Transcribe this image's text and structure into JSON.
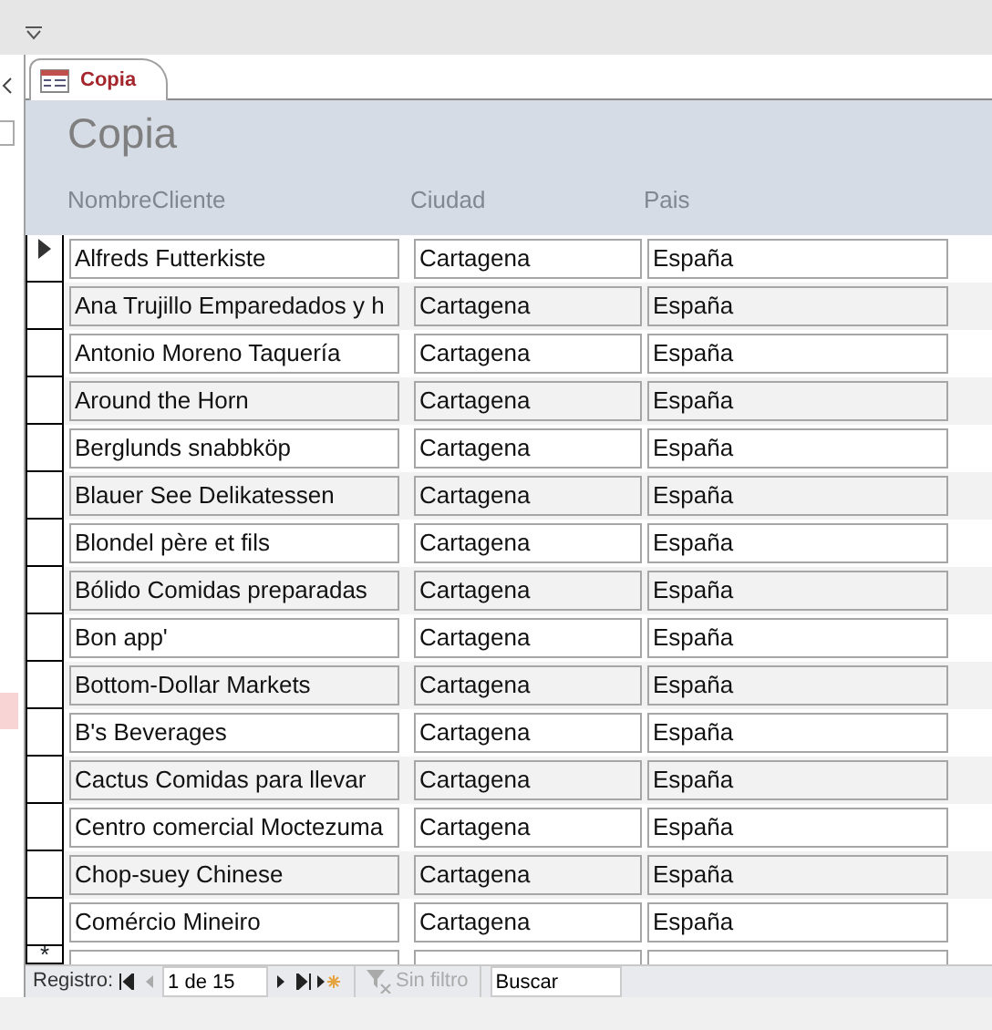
{
  "tab": {
    "label": "Copia",
    "selected": true
  },
  "form": {
    "title": "Copia",
    "columns": [
      "NombreCliente",
      "Ciudad",
      "Pais"
    ],
    "rows": [
      {
        "cells": [
          "Alfreds Futterkiste",
          "Cartagena",
          "España"
        ],
        "current": true
      },
      {
        "cells": [
          "Ana Trujillo Emparedados y h",
          "Cartagena",
          "España"
        ],
        "current": false
      },
      {
        "cells": [
          "Antonio Moreno Taquería",
          "Cartagena",
          "España"
        ],
        "current": false
      },
      {
        "cells": [
          "Around the Horn",
          "Cartagena",
          "España"
        ],
        "current": false
      },
      {
        "cells": [
          "Berglunds snabbköp",
          "Cartagena",
          "España"
        ],
        "current": false
      },
      {
        "cells": [
          "Blauer See Delikatessen",
          "Cartagena",
          "España"
        ],
        "current": false
      },
      {
        "cells": [
          "Blondel père et fils",
          "Cartagena",
          "España"
        ],
        "current": false
      },
      {
        "cells": [
          "Bólido Comidas preparadas",
          "Cartagena",
          "España"
        ],
        "current": false
      },
      {
        "cells": [
          "Bon app'",
          "Cartagena",
          "España"
        ],
        "current": false
      },
      {
        "cells": [
          "Bottom-Dollar Markets",
          "Cartagena",
          "España"
        ],
        "current": false
      },
      {
        "cells": [
          "B's Beverages",
          "Cartagena",
          "España"
        ],
        "current": false
      },
      {
        "cells": [
          "Cactus Comidas para llevar",
          "Cartagena",
          "España"
        ],
        "current": false
      },
      {
        "cells": [
          "Centro comercial Moctezuma",
          "Cartagena",
          "España"
        ],
        "current": false
      },
      {
        "cells": [
          "Chop-suey Chinese",
          "Cartagena",
          "España"
        ],
        "current": false
      },
      {
        "cells": [
          "Comércio Mineiro",
          "Cartagena",
          "España"
        ],
        "current": false
      }
    ],
    "new_row_marker": "*"
  },
  "navigation": {
    "label": "Registro:",
    "position": "1 de 15",
    "filter": {
      "label": "Sin filtro",
      "disabled": true
    },
    "search": {
      "value": "Buscar"
    }
  }
}
